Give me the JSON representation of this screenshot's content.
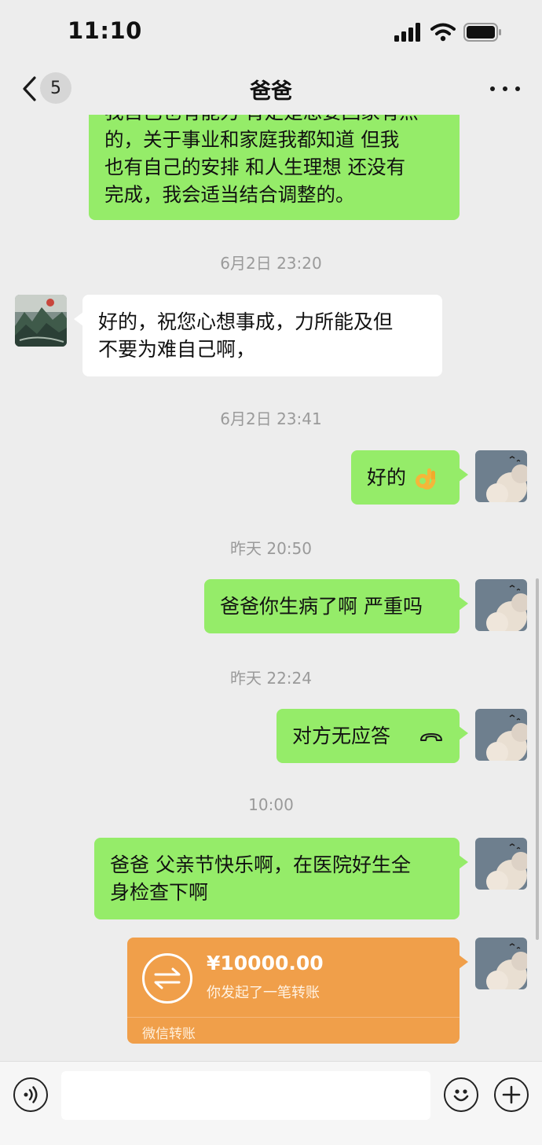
{
  "status_bar": {
    "time": "11:10",
    "icons": [
      "signal-icon",
      "wifi-icon",
      "battery-icon"
    ]
  },
  "nav": {
    "back_icon": "chevron-left-icon",
    "unread_count": "5",
    "title": "爸爸",
    "more_icon": "more-icon"
  },
  "colors": {
    "background": "#ededed",
    "sent_bubble": "#95ec69",
    "received_bubble": "#ffffff",
    "transfer_card": "#f09f4a"
  },
  "messages": [
    {
      "type": "sent",
      "lines": [
        "我自己也有能力 肯定是想要回家有点",
        "的，关于事业和家庭我都知道 但我",
        "也有自己的安排 和人生理想 还没有",
        "完成，我会适当结合调整的。"
      ]
    },
    {
      "type": "timestamp",
      "text": "6月2日 23:20"
    },
    {
      "type": "received",
      "lines": [
        "好的，祝您心想事成，力所能及但",
        "不要为难自己啊，"
      ]
    },
    {
      "type": "timestamp",
      "text": "6月2日 23:41"
    },
    {
      "type": "sent",
      "text": "好的",
      "emoji": "ok-hand-emoji"
    },
    {
      "type": "timestamp",
      "text": "昨天 20:50"
    },
    {
      "type": "sent",
      "text": "爸爸你生病了啊 严重吗"
    },
    {
      "type": "timestamp",
      "text": "昨天 22:24"
    },
    {
      "type": "sent",
      "text": "对方无应答",
      "icon": "hangup-icon"
    },
    {
      "type": "timestamp",
      "text": "10:00"
    },
    {
      "type": "sent",
      "lines": [
        "爸爸 父亲节快乐啊，在医院好生全",
        "身检查下啊"
      ]
    },
    {
      "type": "transfer",
      "amount": "¥10000.00",
      "description": "你发起了一笔转账",
      "footer": "微信转账"
    }
  ],
  "input_bar": {
    "voice_icon": "voice-icon",
    "input_value": "",
    "emoji_icon": "smiley-icon",
    "plus_icon": "plus-icon"
  }
}
